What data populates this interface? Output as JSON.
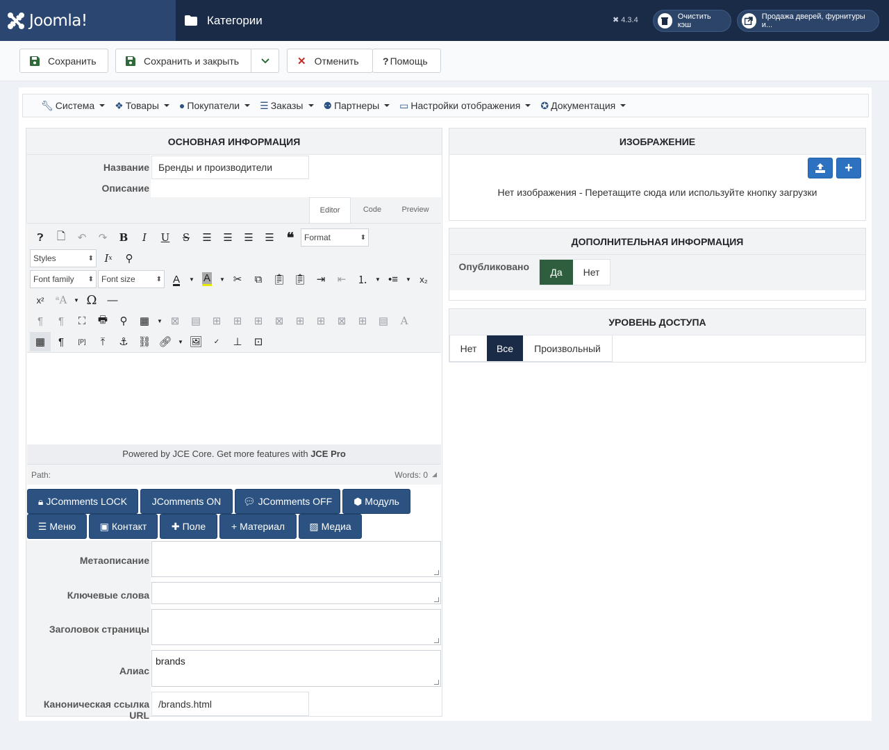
{
  "header": {
    "logo": "Joomla!",
    "page_title": "Категории",
    "version": "4.3.4",
    "clear_cache": "Очистить кэш",
    "site_link": "Продажа дверей, фурнитуры и..."
  },
  "toolbar": {
    "save": "Сохранить",
    "save_close": "Сохранить и закрыть",
    "cancel": "Отменить",
    "help": "Помощь"
  },
  "menubar": {
    "items": [
      "Система",
      "Товары",
      "Покупатели",
      "Заказы",
      "Партнеры",
      "Настройки отображения",
      "Документация"
    ]
  },
  "main_info": {
    "heading": "ОСНОВНАЯ ИНФОРМАЦИЯ",
    "name_label": "Название",
    "name_value": "Бренды и производители",
    "desc_label": "Описание",
    "tabs": [
      "Editor",
      "Code",
      "Preview"
    ],
    "format": "Format",
    "styles": "Styles",
    "font_family": "Font family",
    "font_size": "Font size",
    "powered_prefix": "Powered by JCE Core. Get more features with ",
    "powered_bold": "JCE Pro",
    "path": "Path:",
    "words": "Words: 0",
    "buttons": [
      "JComments LOCK",
      "JComments ON",
      "JComments OFF",
      "Модуль",
      "Меню",
      "Контакт",
      "Поле",
      "Материал",
      "Медиа"
    ],
    "meta_desc_label": "Метаописание",
    "keywords_label": "Ключевые слова",
    "page_title_label": "Заголовок страницы",
    "alias_label": "Алиас",
    "alias_value": "brands",
    "canonical_label": "Каноническая ссылка URL",
    "canonical_value": "/brands.html"
  },
  "image": {
    "heading": "ИЗОБРАЖЕНИЕ",
    "empty_text": "Нет изображения - Перетащите сюда или используйте кнопку загрузки"
  },
  "extra": {
    "heading": "ДОПОЛНИТЕЛЬНАЯ ИНФОРМАЦИЯ",
    "published_label": "Опубликовано",
    "yes": "Да",
    "no": "Нет"
  },
  "access": {
    "heading": "УРОВЕНЬ ДОСТУПА",
    "options": [
      "Нет",
      "Все",
      "Произвольный"
    ]
  },
  "colors": {
    "header_bg": "#1a2b47",
    "accent_blue": "#2b5281",
    "yes_active": "#2f5e3f",
    "all_active": "#1a2b47",
    "cancel_red": "#c52827"
  }
}
